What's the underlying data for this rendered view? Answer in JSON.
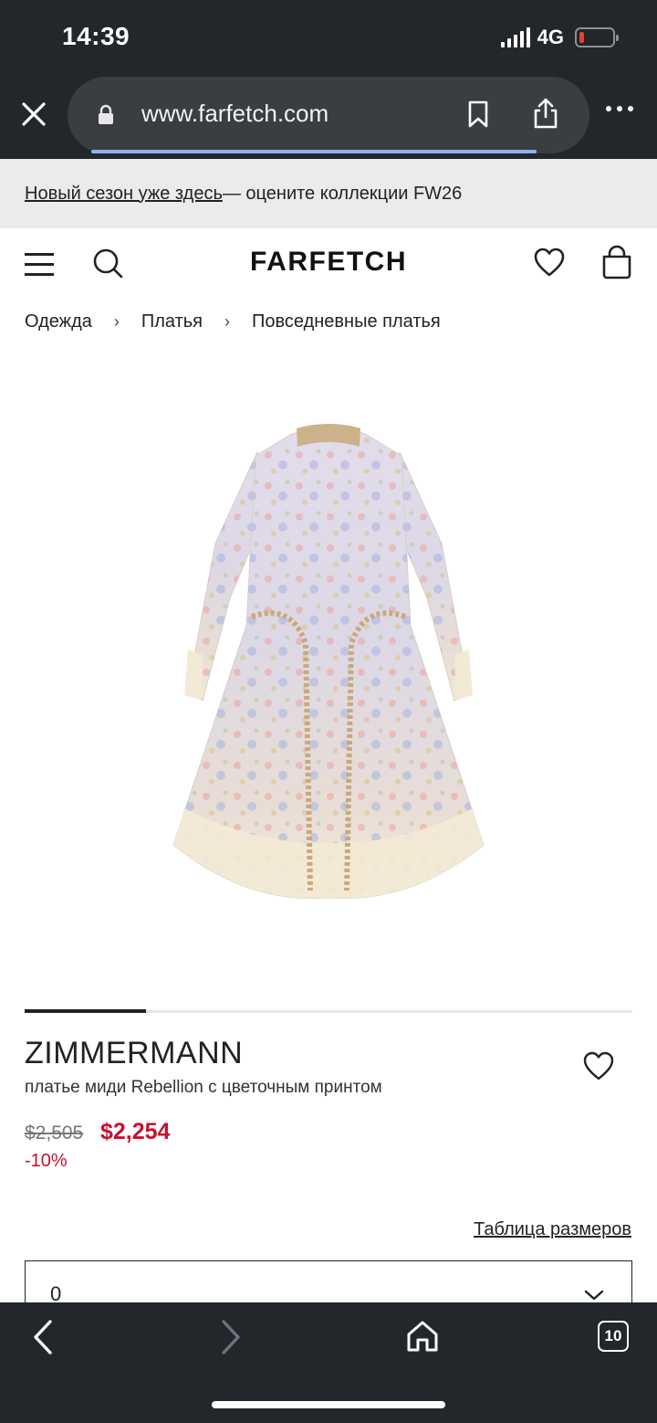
{
  "status_bar": {
    "time": "14:39",
    "network": "4G",
    "battery_level": 0.15,
    "battery_color": "#e0413a"
  },
  "browser": {
    "url": "www.farfetch.com",
    "open_tabs": "10"
  },
  "promo": {
    "link_text": "Новый сезон уже здесь",
    "rest_text": " — оцените коллекции FW26"
  },
  "header": {
    "logo": "FARFETCH"
  },
  "breadcrumb": {
    "items": [
      "Одежда",
      "Платья",
      "Повседневные платья"
    ],
    "separator": "›"
  },
  "gallery": {
    "current_image": 1,
    "image_count": 5
  },
  "product": {
    "brand": "ZIMMERMANN",
    "description": "платье миди Rebellion с цветочным принтом",
    "price_old": "$2,505",
    "price_new": "$2,254",
    "discount": "-10%",
    "price_color": "#c8102e"
  },
  "size": {
    "guide_label": "Таблица размеров",
    "selected": "0"
  }
}
